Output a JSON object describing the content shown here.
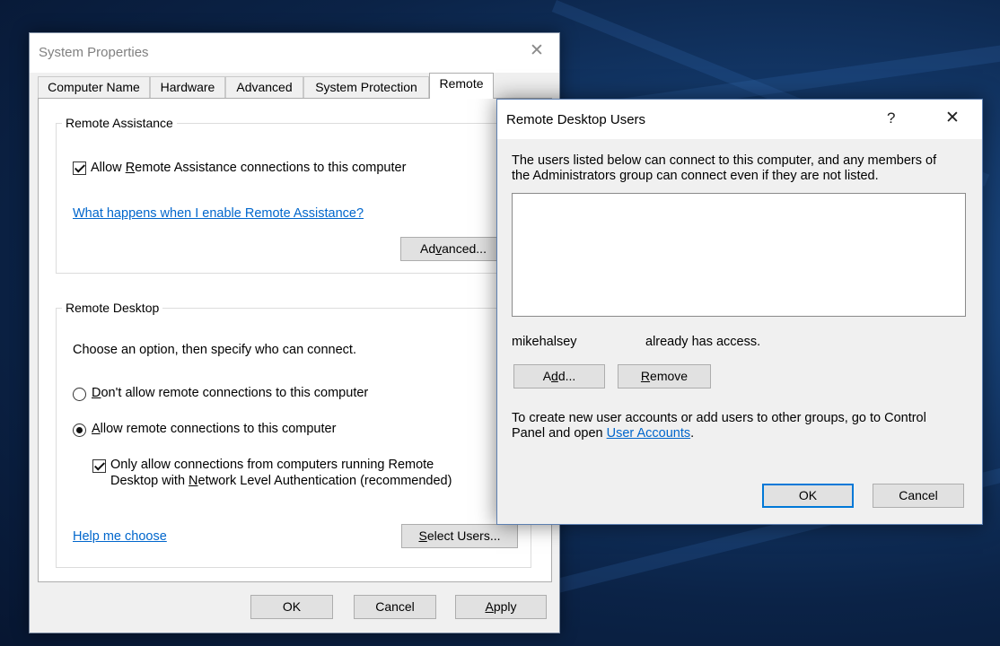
{
  "system_properties": {
    "title": "System Properties",
    "close_glyph": "✕",
    "tabs": [
      {
        "label": "Computer Name"
      },
      {
        "label": "Hardware"
      },
      {
        "label": "Advanced"
      },
      {
        "label": "System Protection"
      },
      {
        "label": "Remote"
      }
    ],
    "active_tab": "Remote",
    "remote_assistance": {
      "heading": "Remote Assistance",
      "allow_checkbox": {
        "pre": "Allow ",
        "key": "R",
        "post": "emote Assistance connections to this computer",
        "checked": true
      },
      "help_link": "What happens when I enable Remote Assistance?",
      "advanced_button": {
        "pre": "Ad",
        "key": "v",
        "post": "anced..."
      }
    },
    "remote_desktop": {
      "heading": "Remote Desktop",
      "instruction": "Choose an option, then specify who can connect.",
      "option_dont": {
        "pre": "",
        "key": "D",
        "post": "on't allow remote connections to this computer",
        "selected": false
      },
      "option_allow": {
        "pre": "",
        "key": "A",
        "post": "llow remote connections to this computer",
        "selected": true
      },
      "nla_checkbox": {
        "line1": "Only allow connections from computers running Remote",
        "line2_pre": "Desktop with ",
        "line2_key": "N",
        "line2_post": "etwork Level Authentication (recommended)",
        "checked": true
      },
      "help_link": "Help me choose",
      "select_users_button": {
        "pre": "",
        "key": "S",
        "post": "elect Users..."
      }
    },
    "buttons": {
      "ok": "OK",
      "cancel": "Cancel",
      "apply": {
        "pre": "",
        "key": "A",
        "post": "pply"
      }
    }
  },
  "remote_desktop_users": {
    "title": "Remote Desktop Users",
    "help_glyph": "?",
    "close_glyph": "✕",
    "description_line1": "The users listed below can connect to this computer, and any members of",
    "description_line2": "the Administrators group can connect even if they are not listed.",
    "users": [],
    "current_user": "mikehalsey",
    "access_status": "already has access.",
    "add_button": {
      "pre": "A",
      "key": "d",
      "post": "d..."
    },
    "remove_button": {
      "pre": "",
      "key": "R",
      "post": "emove"
    },
    "footer_line1": "To create new user accounts or add users to other groups, go to Control",
    "footer_line2_pre": "Panel and open ",
    "footer_link": "User Accounts",
    "footer_line2_post": ".",
    "ok_button": "OK",
    "cancel_button": "Cancel"
  },
  "colors": {
    "desktop_background": "#0b2347",
    "link": "#0066cc",
    "default_button_border": "#0078d7"
  }
}
